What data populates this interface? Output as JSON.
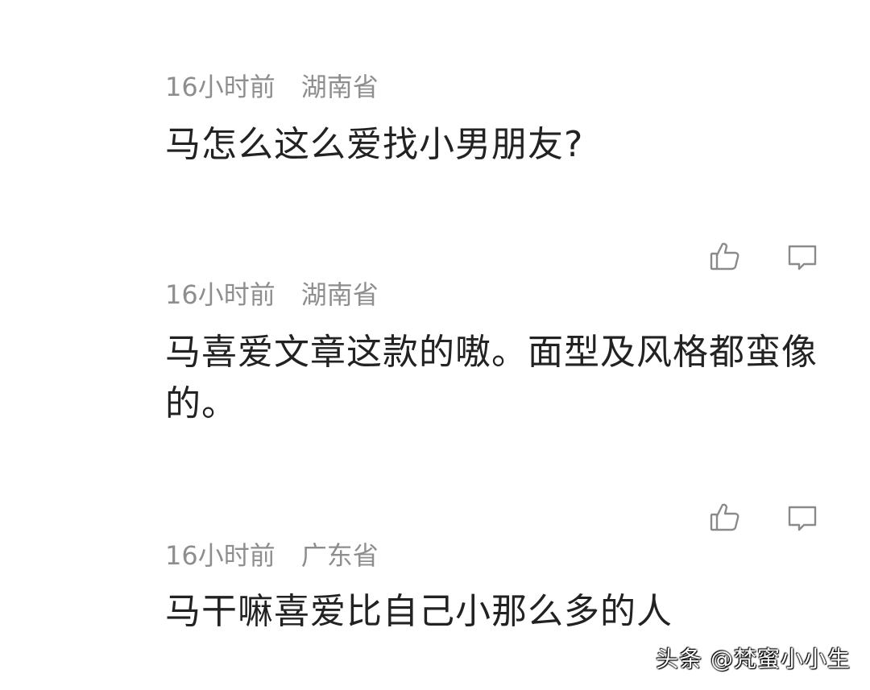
{
  "comments": [
    {
      "time": "16小时前",
      "region": "湖南省",
      "text": "马怎么这么爱找小男朋友?"
    },
    {
      "time": "16小时前",
      "region": "湖南省",
      "text": "马喜爱文章这款的嗷。面型及风格都蛮像的。"
    },
    {
      "time": "16小时前",
      "region": "广东省",
      "text": "马干嘛喜爱比自己小那么多的人"
    }
  ],
  "icons": {
    "like": "thumbs-up-icon",
    "reply": "comment-bubble-icon"
  },
  "watermark": "头条 @梵蜜小小生"
}
